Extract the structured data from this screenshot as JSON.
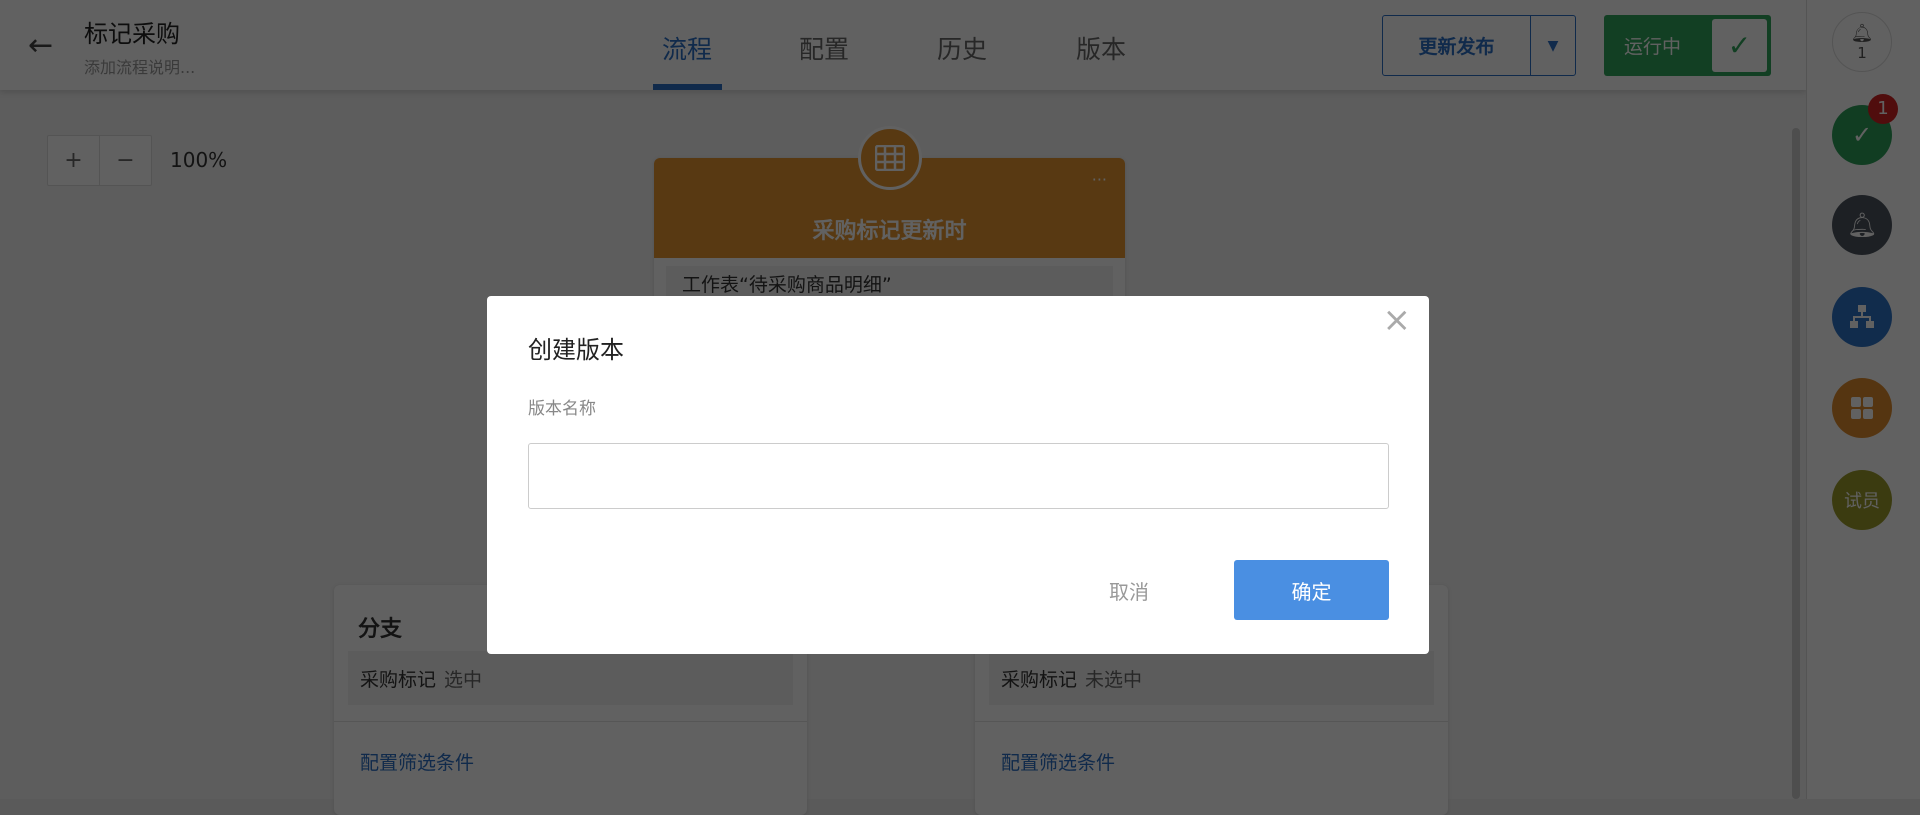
{
  "header": {
    "title": "标记采购",
    "subtitle": "添加流程说明...",
    "tabs": [
      {
        "label": "流程"
      },
      {
        "label": "配置"
      },
      {
        "label": "历史"
      },
      {
        "label": "版本"
      }
    ],
    "active_tab": "流程",
    "publish_label": "更新发布",
    "status_label": "运行中"
  },
  "sidebar": {
    "notification_count": "1",
    "todo_badge": "1",
    "user_label": "试员"
  },
  "canvas": {
    "zoom_in": "+",
    "zoom_out": "−",
    "zoom_level": "100%",
    "trigger": {
      "title": "采购标记更新时",
      "more": "···",
      "body": "工作表“待采购商品明细”"
    },
    "branches": [
      {
        "title": "分支",
        "field": "采购标记",
        "value": "选中",
        "link": "配置筛选条件"
      },
      {
        "title": "",
        "field": "采购标记",
        "value": "未选中",
        "link": "配置筛选条件"
      }
    ]
  },
  "modal": {
    "title": "创建版本",
    "field_label": "版本名称",
    "field_value": "",
    "cancel_label": "取消",
    "confirm_label": "确定"
  },
  "colors": {
    "accent": "#2b6fc6",
    "running": "#2fa55b",
    "trigger": "#e8962f",
    "confirm": "#4a8fe2"
  }
}
